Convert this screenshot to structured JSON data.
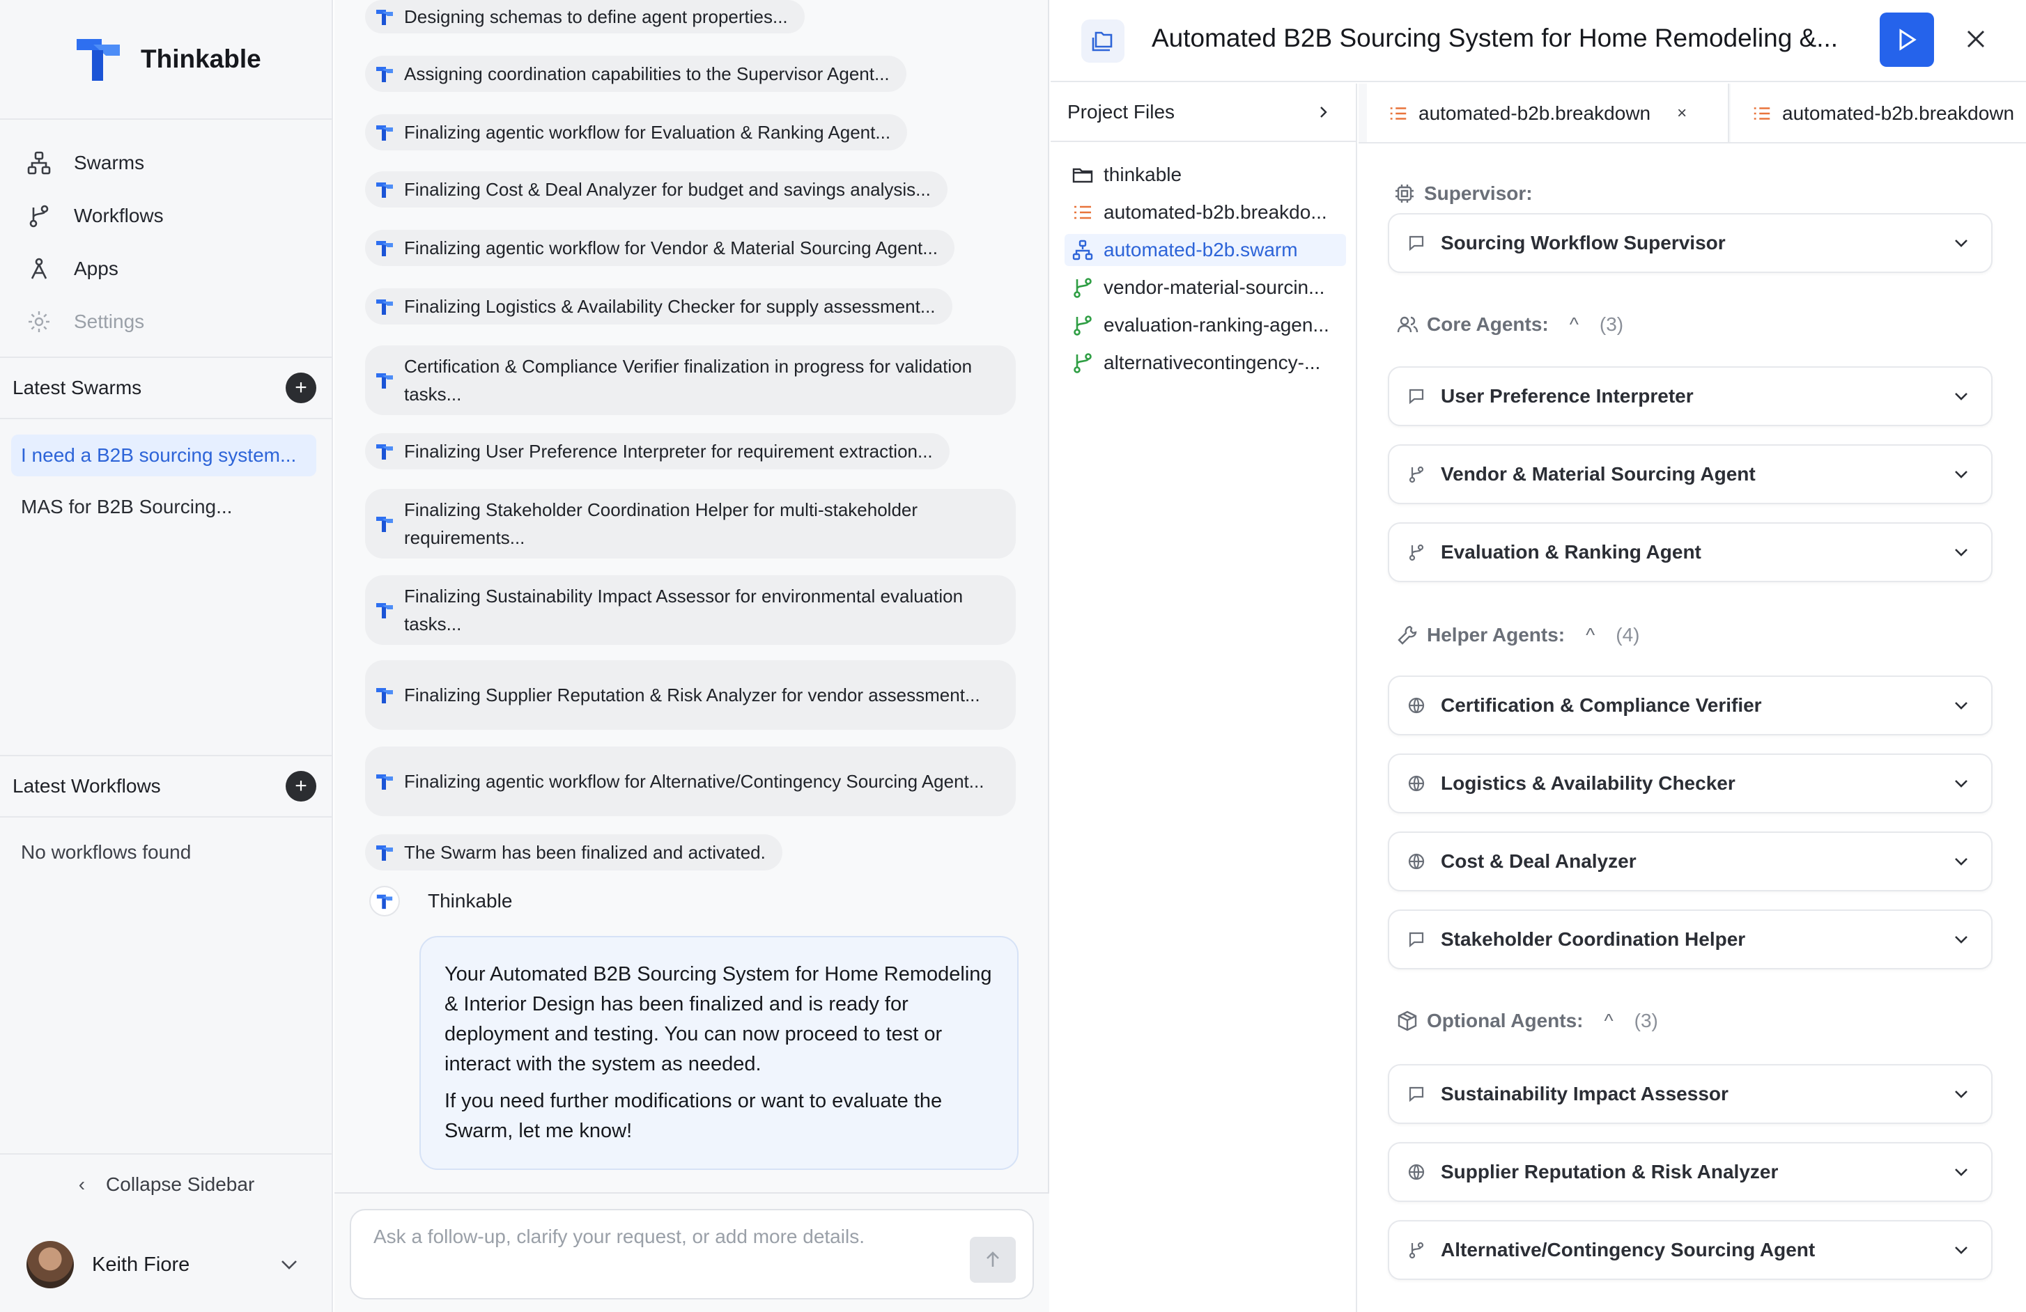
{
  "app": {
    "name": "Thinkable"
  },
  "sidebar": {
    "nav": [
      {
        "label": "Swarms",
        "icon": "swarm-icon"
      },
      {
        "label": "Workflows",
        "icon": "workflow-icon"
      },
      {
        "label": "Apps",
        "icon": "apps-icon"
      },
      {
        "label": "Settings",
        "icon": "gear-icon"
      }
    ],
    "latest_swarms": {
      "title": "Latest Swarms",
      "items": [
        "I need a B2B sourcing system...",
        "MAS for B2B Sourcing..."
      ]
    },
    "latest_workflows": {
      "title": "Latest Workflows",
      "empty": "No workflows found"
    },
    "collapse_label": "Collapse Sidebar",
    "user": {
      "name": "Keith Fiore"
    }
  },
  "chat": {
    "steps": [
      "Designing schemas to define agent properties...",
      "Assigning coordination capabilities to the Supervisor Agent...",
      "Finalizing agentic workflow for Evaluation & Ranking Agent...",
      "Finalizing Cost & Deal Analyzer for budget and savings analysis...",
      "Finalizing agentic workflow for Vendor & Material Sourcing Agent...",
      "Finalizing Logistics & Availability Checker for supply assessment...",
      "Certification & Compliance Verifier finalization in progress for validation tasks...",
      "Finalizing User Preference Interpreter for requirement extraction...",
      "Finalizing Stakeholder Coordination Helper for multi-stakeholder requirements...",
      "Finalizing Sustainability Impact Assessor for environmental evaluation tasks...",
      "Finalizing Supplier Reputation & Risk Analyzer for vendor assessment...",
      "Finalizing agentic workflow for Alternative/Contingency Sourcing Agent...",
      "The Swarm has been finalized and activated."
    ],
    "bot_name": "Thinkable",
    "message": {
      "p1": "Your Automated B2B Sourcing System for Home Remodeling & Interior Design has been finalized and is ready for deployment and testing. You can now proceed to test or interact with the system as needed.",
      "p2": "If you need further modifications or want to evaluate the Swarm, let me know!"
    },
    "input": {
      "placeholder": "Ask a follow-up, clarify your request, or add more details."
    }
  },
  "panel": {
    "title": "Automated B2B Sourcing System for Home Remodeling &...",
    "files": {
      "title": "Project Files",
      "items": [
        {
          "name": "thinkable",
          "icon": "folder-icon"
        },
        {
          "name": "automated-b2b.breakdo...",
          "icon": "list-icon"
        },
        {
          "name": "automated-b2b.swarm",
          "icon": "swarm-icon"
        },
        {
          "name": "vendor-material-sourcin...",
          "icon": "branch-icon"
        },
        {
          "name": "evaluation-ranking-agen...",
          "icon": "branch-icon"
        },
        {
          "name": "alternativecontingency-...",
          "icon": "branch-icon"
        }
      ]
    },
    "tabs": [
      {
        "label": "automated-b2b.breakdown",
        "close": "×"
      },
      {
        "label": "automated-b2b.breakdown"
      }
    ],
    "supervisor": {
      "title": "Supervisor:",
      "agent": "Sourcing Workflow Supervisor"
    },
    "core": {
      "title": "Core Agents:",
      "count": "(3)",
      "agents": [
        "User Preference Interpreter",
        "Vendor & Material Sourcing Agent",
        "Evaluation & Ranking Agent"
      ]
    },
    "helper": {
      "title": "Helper Agents:",
      "count": "(4)",
      "agents": [
        "Certification & Compliance Verifier",
        "Logistics & Availability Checker",
        "Cost & Deal Analyzer",
        "Stakeholder Coordination Helper"
      ]
    },
    "optional": {
      "title": "Optional Agents:",
      "count": "(3)",
      "agents": [
        "Sustainability Impact Assessor",
        "Supplier Reputation & Risk Analyzer",
        "Alternative/Contingency Sourcing Agent"
      ]
    },
    "colors": {
      "accent": "#2563eb",
      "file_orange": "#e8743b",
      "file_green": "#2f9e44"
    }
  }
}
